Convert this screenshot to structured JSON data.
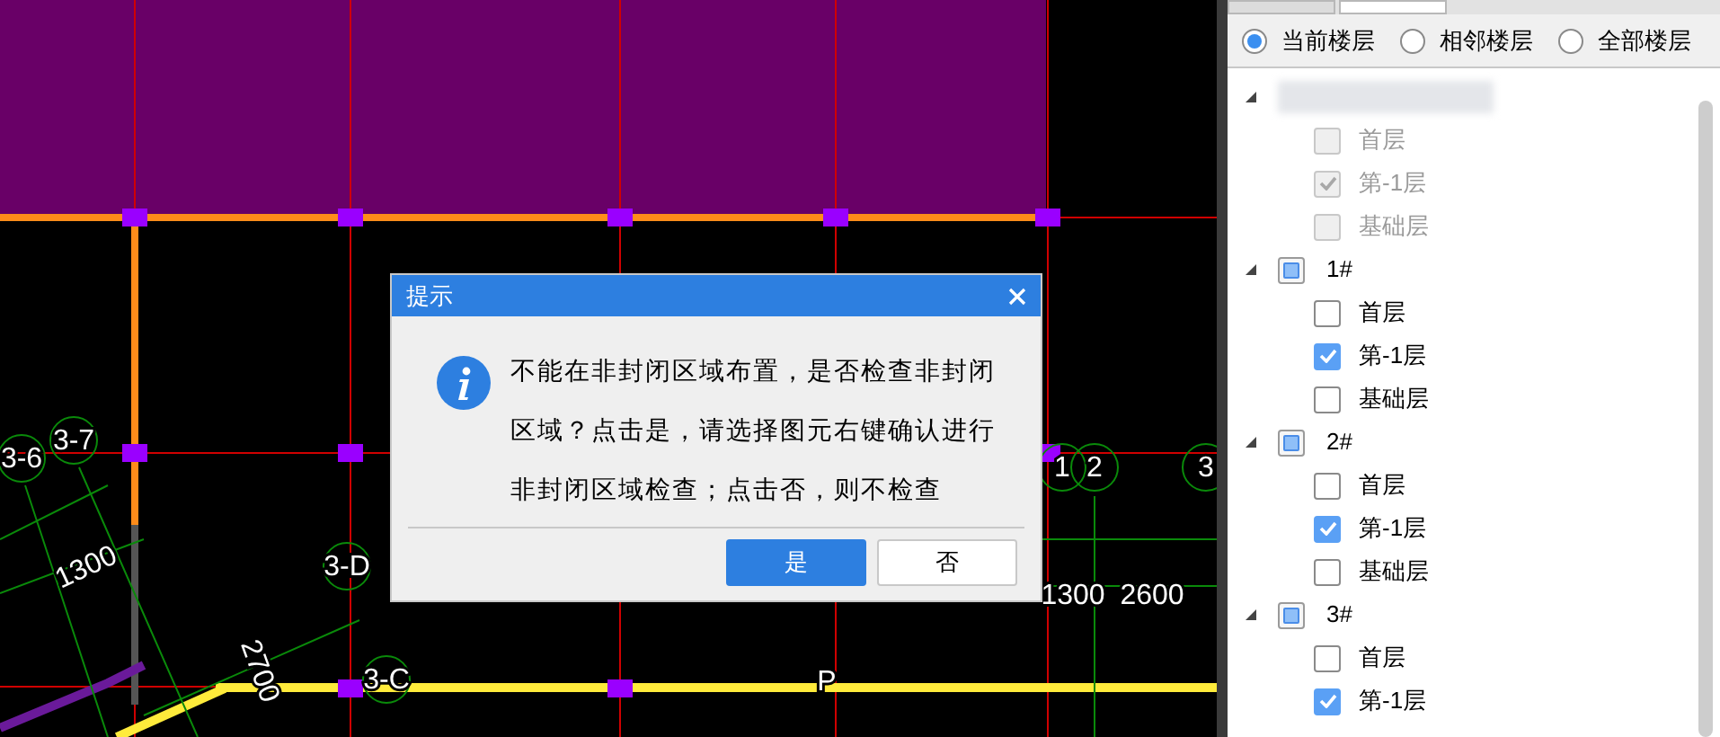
{
  "canvas": {
    "labels": [
      {
        "text": "3-6"
      },
      {
        "text": "3-7"
      },
      {
        "text": "1300"
      },
      {
        "text": "3-D"
      },
      {
        "text": "2700"
      },
      {
        "text": "3-C"
      },
      {
        "text": "1"
      },
      {
        "text": "2"
      },
      {
        "text": "3"
      },
      {
        "text": "1300"
      },
      {
        "text": "2600"
      },
      {
        "text": "P"
      }
    ]
  },
  "dialog": {
    "title": "提示",
    "message": "不能在非封闭区域布置，是否检查非封闭区域？点击是，请选择图元右键确认进行非封闭区域检查；点击否，则不检查",
    "buttons": [
      {
        "label": "是",
        "primary": true
      },
      {
        "label": "否",
        "primary": false
      }
    ]
  },
  "panel": {
    "scope_options": [
      {
        "label": "当前楼层",
        "selected": true
      },
      {
        "label": "相邻楼层",
        "selected": false
      },
      {
        "label": "全部楼层",
        "selected": false
      }
    ],
    "tree": [
      {
        "expanded": true,
        "disabled": true,
        "children": [
          {
            "label": "首层",
            "checked": false
          },
          {
            "label": "第-1层",
            "checked": true
          },
          {
            "label": "基础层",
            "checked": false
          }
        ]
      },
      {
        "label": "1#",
        "expanded": true,
        "partial": true,
        "disabled": false,
        "children": [
          {
            "label": "首层",
            "checked": false
          },
          {
            "label": "第-1层",
            "checked": true
          },
          {
            "label": "基础层",
            "checked": false
          }
        ]
      },
      {
        "label": "2#",
        "expanded": true,
        "partial": true,
        "disabled": false,
        "children": [
          {
            "label": "首层",
            "checked": false
          },
          {
            "label": "第-1层",
            "checked": true
          },
          {
            "label": "基础层",
            "checked": false
          }
        ]
      },
      {
        "label": "3#",
        "expanded": true,
        "partial": true,
        "disabled": false,
        "children": [
          {
            "label": "首层",
            "checked": false
          },
          {
            "label": "第-1层",
            "checked": true
          }
        ]
      }
    ]
  }
}
